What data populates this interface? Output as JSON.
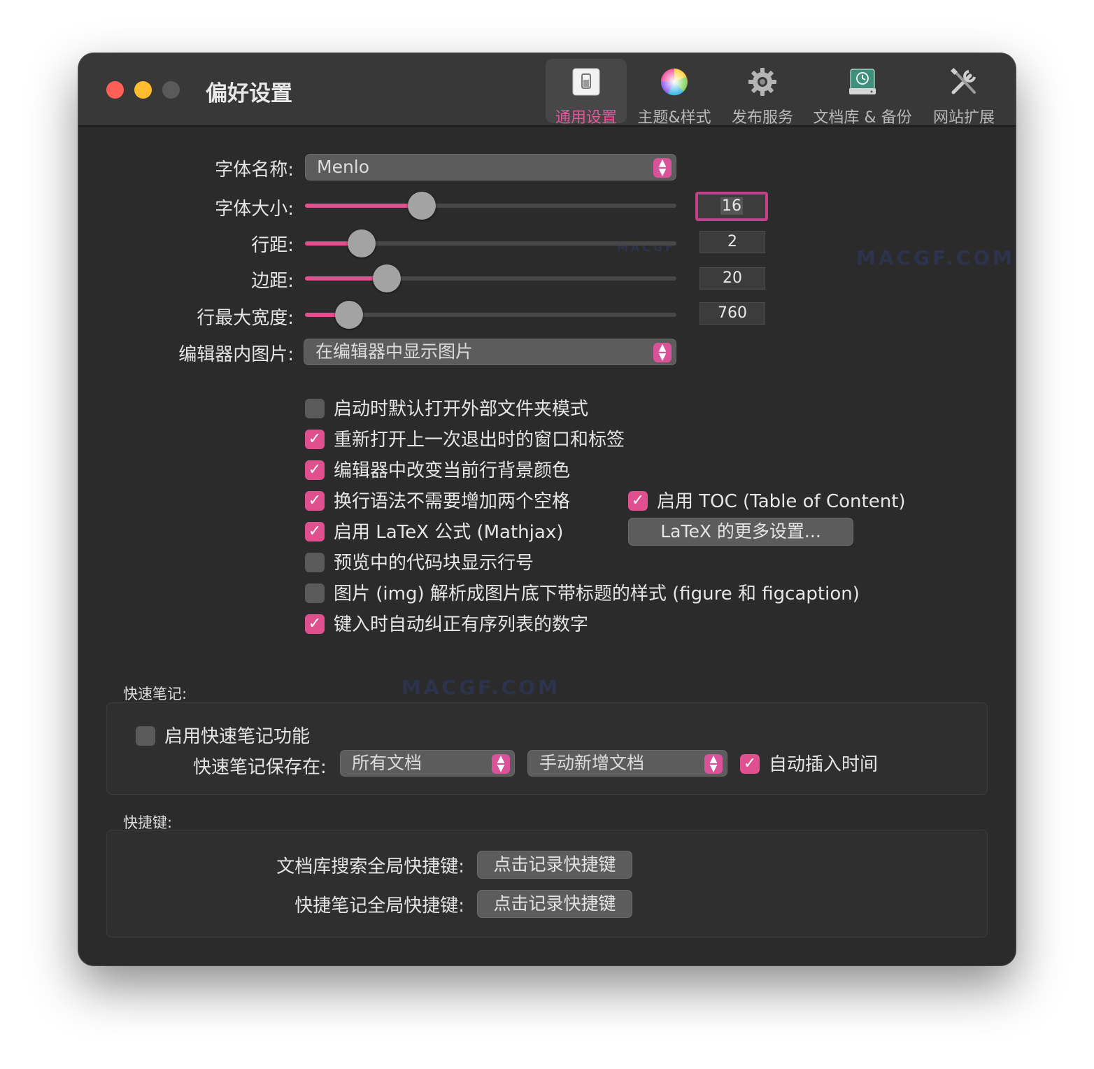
{
  "window": {
    "title": "偏好设置"
  },
  "toolbar": {
    "tabs": [
      {
        "label": "通用设置",
        "icon": "switch-icon",
        "active": true
      },
      {
        "label": "主题&样式",
        "icon": "color-wheel-icon",
        "active": false
      },
      {
        "label": "发布服务",
        "icon": "gear-icon",
        "active": false
      },
      {
        "label": "文档库 & 备份",
        "icon": "time-machine-drive-icon",
        "active": false
      },
      {
        "label": "网站扩展",
        "icon": "tools-icon",
        "active": false
      }
    ]
  },
  "general": {
    "font_name_label": "字体名称:",
    "font_name_value": "Menlo",
    "font_size_label": "字体大小:",
    "font_size_value": "16",
    "line_spacing_label": "行距:",
    "line_spacing_value": "2",
    "margin_label": "边距:",
    "margin_value": "20",
    "max_width_label": "行最大宽度:",
    "max_width_value": "760",
    "image_label": "编辑器内图片:",
    "image_value": "在编辑器中显示图片"
  },
  "sliders": {
    "font_size_fraction": 0.315,
    "line_spacing_fraction": 0.152,
    "margin_fraction": 0.22,
    "max_width_fraction": 0.118
  },
  "options": [
    {
      "label": "启动时默认打开外部文件夹模式",
      "checked": false
    },
    {
      "label": "重新打开上一次退出时的窗口和标签",
      "checked": true
    },
    {
      "label": "编辑器中改变当前行背景颜色",
      "checked": true
    },
    {
      "label": "换行语法不需要增加两个空格",
      "checked": true
    },
    {
      "label": "启用 LaTeX 公式 (Mathjax)",
      "checked": true
    },
    {
      "label": "预览中的代码块显示行号",
      "checked": false
    },
    {
      "label": "图片 (img) 解析成图片底下带标题的样式 (figure 和 figcaption)",
      "checked": false
    },
    {
      "label": "键入时自动纠正有序列表的数字",
      "checked": true
    }
  ],
  "toc": {
    "label": "启用 TOC (Table of Content)",
    "checked": true
  },
  "latex_more_button": "LaTeX 的更多设置...",
  "quick_note": {
    "section_label": "快速笔记:",
    "enable_label": "启用快速笔记功能",
    "enable_checked": false,
    "save_label": "快速笔记保存在:",
    "save_location": "所有文档",
    "save_doc": "手动新增文档",
    "auto_time_label": "自动插入时间",
    "auto_time_checked": true
  },
  "shortcuts": {
    "section_label": "快捷键:",
    "search_label": "文档库搜索全局快捷键:",
    "search_button": "点击记录快捷键",
    "note_label": "快捷笔记全局快捷键:",
    "note_button": "点击记录快捷键"
  },
  "watermark": {
    "text": "MACGF.COM",
    "logo_text": "MACGF"
  },
  "colors": {
    "accent": "#e0508f",
    "window_bg": "#2b2b2b",
    "titlebar_bg": "#383838"
  }
}
